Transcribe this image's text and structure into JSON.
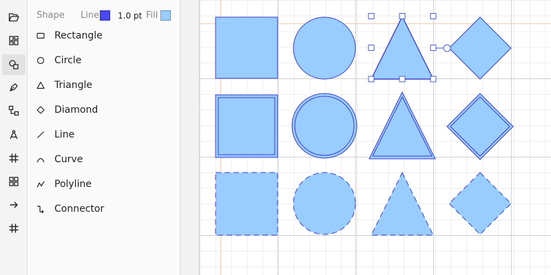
{
  "toolbar": {
    "tools": [
      {
        "name": "open-folder-icon",
        "active": false
      },
      {
        "name": "dashboard-icon",
        "active": false
      },
      {
        "name": "shapes-icon",
        "active": true
      },
      {
        "name": "pen-icon",
        "active": false
      },
      {
        "name": "connect-shapes-icon",
        "active": false
      },
      {
        "name": "compass-icon",
        "active": false
      },
      {
        "name": "grid-hash-icon",
        "active": false
      },
      {
        "name": "layout-icon",
        "active": false
      },
      {
        "name": "arrow-right-icon",
        "active": false
      },
      {
        "name": "grid-hash-icon",
        "active": false
      }
    ]
  },
  "panel": {
    "title": "Shape",
    "line_label": "Line",
    "line_color": "#4848ec",
    "line_width": "1.0 pt",
    "fill_label": "Fill",
    "fill_color": "#99ccff",
    "shapes": [
      {
        "label": "Rectangle",
        "icon": "rectangle-icon"
      },
      {
        "label": "Circle",
        "icon": "circle-icon"
      },
      {
        "label": "Triangle",
        "icon": "triangle-icon"
      },
      {
        "label": "Diamond",
        "icon": "diamond-icon"
      },
      {
        "label": "Line",
        "icon": "line-icon"
      },
      {
        "label": "Curve",
        "icon": "curve-icon"
      },
      {
        "label": "Polyline",
        "icon": "polyline-icon"
      },
      {
        "label": "Connector",
        "icon": "connector-icon"
      }
    ]
  },
  "canvas": {
    "rows": [
      {
        "style": "solid"
      },
      {
        "style": "double"
      },
      {
        "style": "dashed"
      }
    ],
    "columns": [
      "rectangle",
      "circle",
      "triangle",
      "diamond"
    ],
    "selected_shape": "triangle",
    "stroke_color": "#3c3cd0",
    "fill_color": "#99ccff"
  }
}
